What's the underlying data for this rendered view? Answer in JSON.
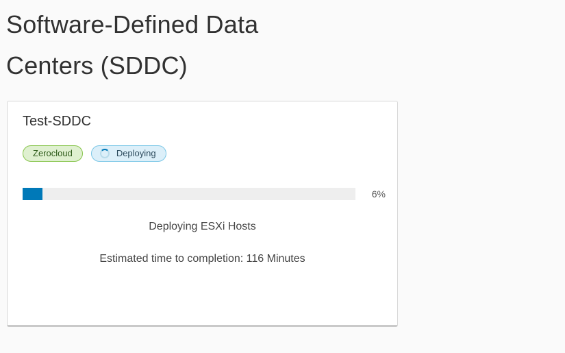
{
  "page": {
    "title": "Software-Defined Data Centers (SDDC)"
  },
  "sddc_card": {
    "name": "Test-SDDC",
    "badges": {
      "provider": "Zerocloud",
      "status": "Deploying"
    },
    "progress": {
      "percent": 6,
      "label": "6%"
    },
    "status_message": "Deploying ESXi Hosts",
    "eta_message": "Estimated time to completion: 116 Minutes"
  },
  "colors": {
    "progress_fill": "#0079b8",
    "badge_green_border": "#86c44a",
    "badge_blue_border": "#79c6e6"
  },
  "icons": {
    "status_spinner": "spinner-icon"
  }
}
